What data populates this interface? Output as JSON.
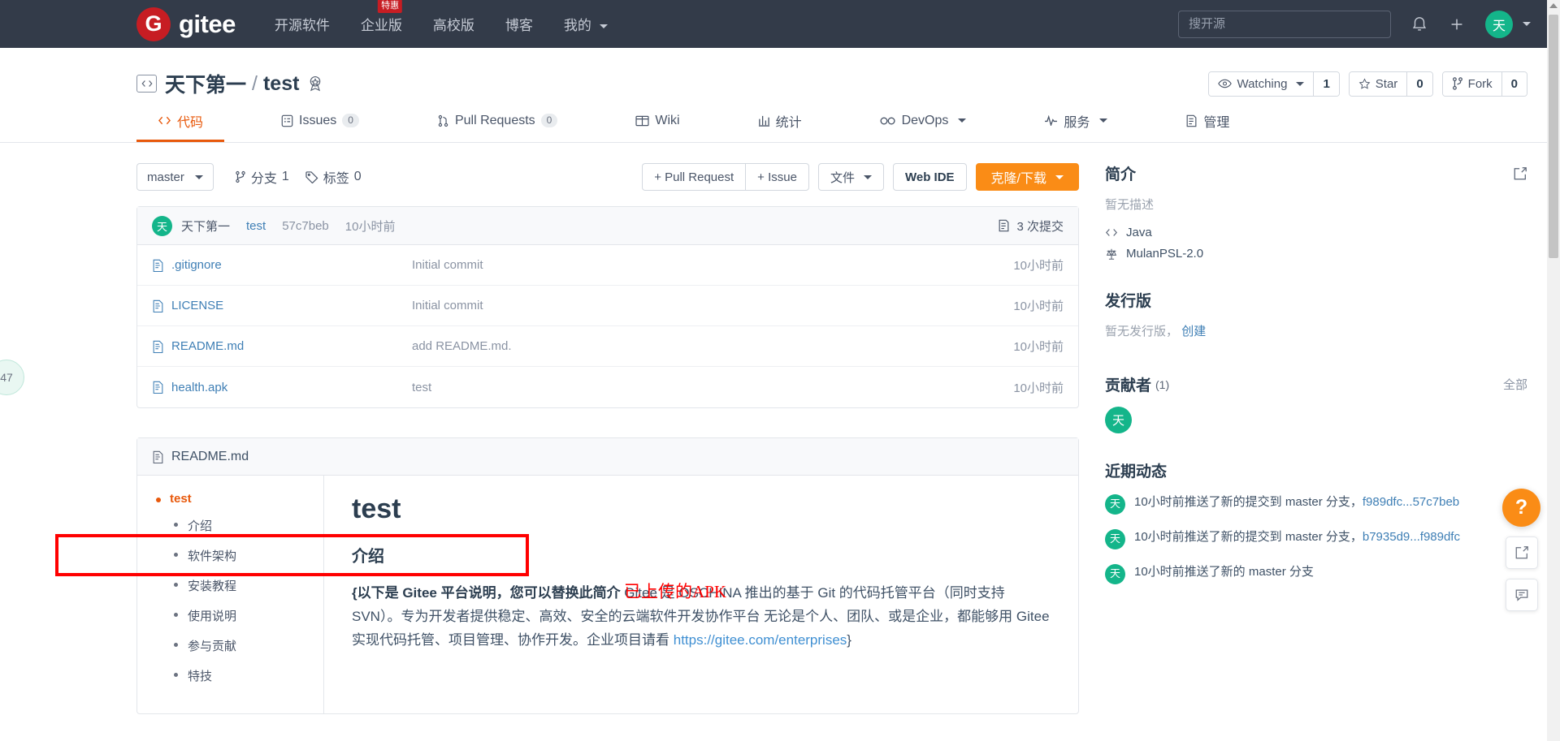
{
  "navbar": {
    "brand_mark": "G",
    "brand_text": "gitee",
    "links": [
      {
        "label": "开源软件",
        "badge": null
      },
      {
        "label": "企业版",
        "badge": "特惠"
      },
      {
        "label": "高校版",
        "badge": null
      },
      {
        "label": "博客",
        "badge": null
      },
      {
        "label": "我的",
        "badge": null,
        "caret": true
      }
    ],
    "search_placeholder": "搜开源",
    "search_value": "",
    "bell_icon": "bell-icon",
    "plus_icon": "plus-icon",
    "avatar_text": "天"
  },
  "repo": {
    "owner": "天下第一",
    "separator": "/",
    "name": "test",
    "code_icon": "</>",
    "medal_icon": "medal-icon",
    "watch_label": "Watching",
    "watch_count": "1",
    "star_label": "Star",
    "star_count": "0",
    "fork_label": "Fork",
    "fork_count": "0"
  },
  "tabs": [
    {
      "label": "代码",
      "icon": "code-icon",
      "count": null,
      "active": true
    },
    {
      "label": "Issues",
      "icon": "issue-icon",
      "count": "0",
      "active": false
    },
    {
      "label": "Pull Requests",
      "icon": "pr-icon",
      "count": "0",
      "active": false
    },
    {
      "label": "Wiki",
      "icon": "wiki-icon",
      "count": null,
      "active": false
    },
    {
      "label": "统计",
      "icon": "chart-icon",
      "count": null,
      "active": false
    },
    {
      "label": "DevOps",
      "icon": "infinity-icon",
      "count": null,
      "active": false,
      "caret": true
    },
    {
      "label": "服务",
      "icon": "pulse-icon",
      "count": null,
      "active": false,
      "caret": true
    },
    {
      "label": "管理",
      "icon": "settings-icon",
      "count": null,
      "active": false
    }
  ],
  "toolbar": {
    "branch": "master",
    "branches_label": "分支",
    "branches_count": "1",
    "tags_label": "标签",
    "tags_count": "0",
    "pull_request_btn": "+ Pull Request",
    "issue_btn": "+ Issue",
    "files_btn": "文件",
    "webide_btn": "Web IDE",
    "clone_btn": "克隆/下载"
  },
  "commit_bar": {
    "avatar": "天",
    "author": "天下第一",
    "message": "test",
    "sha": "57c7beb",
    "time": "10小时前",
    "commits_label": "3 次提交"
  },
  "files": [
    {
      "name": ".gitignore",
      "message": "Initial commit",
      "time": "10小时前"
    },
    {
      "name": "LICENSE",
      "message": "Initial commit",
      "time": "10小时前"
    },
    {
      "name": "README.md",
      "message": "add README.md.",
      "time": "10小时前"
    },
    {
      "name": "health.apk",
      "message": "test",
      "time": "10小时前"
    }
  ],
  "annotation": {
    "text": "已上传的APK",
    "color": "#ff0000"
  },
  "readme": {
    "filename": "README.md",
    "toc": {
      "root": "test",
      "items": [
        "介绍",
        "软件架构",
        "安装教程",
        "使用说明",
        "参与贡献",
        "特技"
      ]
    },
    "h1": "test",
    "h2": "介绍",
    "body_bold": "{以下是 Gitee 平台说明，您可以替换此简介",
    "body_rest": " Gitee 是 OSCHINA 推出的基于 Git 的代码托管平台（同时支持 SVN）。专为开发者提供稳定、高效、安全的云端软件开发协作平台 无论是个人、团队、或是企业，都能够用 Gitee 实现代码托管、项目管理、协作开发。企业项目请看 ",
    "body_link": "https://gitee.com/enterprises",
    "body_tail": "}"
  },
  "sidebar": {
    "intro_title": "简介",
    "intro_edit_icon": "edit-icon",
    "intro_desc": "暂无描述",
    "language_icon": "code-icon",
    "language": "Java",
    "license_icon": "scale-icon",
    "license": "MulanPSL-2.0",
    "release_title": "发行版",
    "release_none": "暂无发行版，",
    "release_create": "创建",
    "contributors_title": "贡献者",
    "contributors_count": "(1)",
    "contributors_all": "全部",
    "contributors": [
      {
        "avatar": "天"
      }
    ],
    "activity_title": "近期动态",
    "activities": [
      {
        "avatar": "天",
        "text": "10小时前推送了新的提交到 master 分支，",
        "link": "f989dfc...57c7beb"
      },
      {
        "avatar": "天",
        "text": "10小时前推送了新的提交到 master 分支，",
        "link": "b7935d9...f989dfc"
      },
      {
        "avatar": "天",
        "text": "10小时前推送了新的 master 分支",
        "link": ""
      }
    ]
  },
  "floating": {
    "help_label": "?",
    "share_icon": "share-icon",
    "chat_icon": "chat-icon",
    "left_bubble": "47"
  },
  "colors": {
    "navbar_bg": "#333b49",
    "brand_red": "#c71d23",
    "accent_orange": "#e8590c",
    "primary_orange": "#fa8c16",
    "avatar_green": "#14b58a",
    "link_blue": "#3f7fb5",
    "annotation_red": "#ff0000"
  }
}
